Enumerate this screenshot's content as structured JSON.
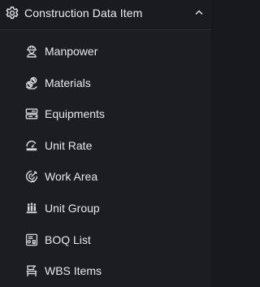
{
  "section": {
    "title": "Construction Data Item",
    "icon": "gear-settings-icon",
    "expanded": true,
    "chevron_icon": "chevron-up-icon"
  },
  "menu": {
    "items": [
      {
        "label": "Manpower",
        "icon": "worker-icon"
      },
      {
        "label": "Materials",
        "icon": "materials-icon"
      },
      {
        "label": "Equipments",
        "icon": "equipment-icon"
      },
      {
        "label": "Unit Rate",
        "icon": "unit-rate-icon"
      },
      {
        "label": "Work Area",
        "icon": "work-area-icon"
      },
      {
        "label": "Unit Group",
        "icon": "unit-group-icon"
      },
      {
        "label": "BOQ List",
        "icon": "boq-list-icon"
      },
      {
        "label": "WBS Items",
        "icon": "wbs-items-icon"
      }
    ]
  },
  "colors": {
    "background": "#1b1d22",
    "text": "#e6e8ec",
    "icon": "#d4d7dc"
  }
}
